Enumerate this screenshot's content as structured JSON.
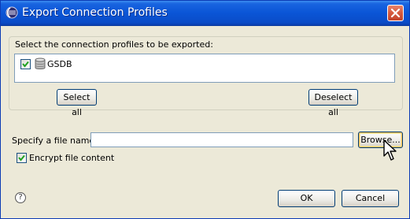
{
  "window": {
    "title": "Export Connection Profiles"
  },
  "profiles": {
    "group_label": "Select the connection profiles to be exported:",
    "items": [
      {
        "label": "GSDB",
        "checked": true
      }
    ],
    "select_all_label": "Select all",
    "deselect_all_label": "Deselect all"
  },
  "file": {
    "label": "Specify a file name:",
    "value": "",
    "browse_label": "Browse..."
  },
  "encrypt": {
    "label": "Encrypt file content",
    "checked": true
  },
  "footer": {
    "help_glyph": "?",
    "ok_label": "OK",
    "cancel_label": "Cancel"
  }
}
